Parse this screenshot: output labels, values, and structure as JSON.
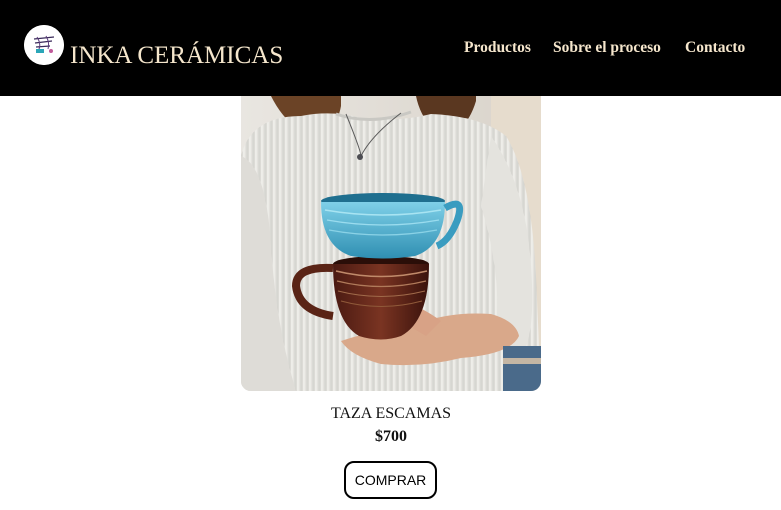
{
  "header": {
    "brand": "INKA CERÁMICAS",
    "logo_icon": "ceramics-logo-icon",
    "nav": [
      {
        "label": "Productos"
      },
      {
        "label": "Sobre el proceso"
      },
      {
        "label": "Contacto"
      }
    ]
  },
  "product": {
    "image": "woman-holding-stacked-mugs",
    "name": "TAZA ESCAMAS",
    "price": "$700",
    "buy_label": "COMPRAR"
  },
  "colors": {
    "header_bg": "#000000",
    "header_text": "#f5e6cc",
    "page_bg": "#ffffff"
  }
}
